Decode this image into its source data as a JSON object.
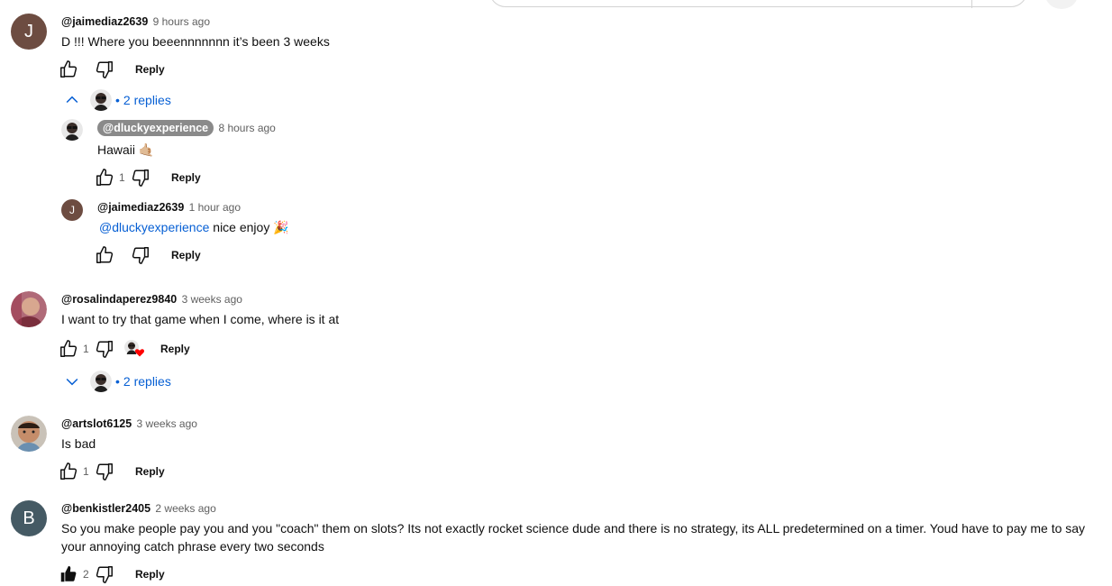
{
  "comments": [
    {
      "handle": "@jaimediaz2639",
      "time": "9 hours ago",
      "avatar_letter": "J",
      "avatar_color": "#6d4c41",
      "text": "D !!! Where you beeennnnnnn it’s been 3 weeks",
      "likes": "",
      "reply_label": "Reply",
      "replies_label": "2 replies",
      "replies": [
        {
          "handle": "@dluckyexperience",
          "time": "8 hours ago",
          "text": "Hawaii 🤙🏼",
          "likes": "1",
          "reply_label": "Reply"
        },
        {
          "handle": "@jaimediaz2639",
          "time": "1 hour ago",
          "avatar_letter": "J",
          "avatar_color": "#6d4c41",
          "mention": "@dluckyexperience",
          "text": " nice enjoy 🎉",
          "likes": "",
          "reply_label": "Reply"
        }
      ]
    },
    {
      "handle": "@rosalindaperez9840",
      "time": "3 weeks ago",
      "text": "I want to try that game when I come, where is it at",
      "likes": "1",
      "reply_label": "Reply",
      "replies_label": "2 replies"
    },
    {
      "handle": "@artslot6125",
      "time": "3 weeks ago",
      "text": "Is bad",
      "likes": "1",
      "reply_label": "Reply"
    },
    {
      "handle": "@benkistler2405",
      "time": "2 weeks ago",
      "avatar_letter": "B",
      "avatar_color": "#455a64",
      "text": "So you make people pay you and you \"coach\" them on slots? Its not exactly rocket science dude and there is no strategy, its ALL predetermined on a timer. Youd have to pay me to say your annoying catch phrase every two seconds",
      "likes": "2",
      "reply_label": "Reply"
    }
  ],
  "colors": {
    "link": "#065fd4",
    "secondary_text": "#606060",
    "creator_badge": "#8a8a8a"
  },
  "icons": [
    "thumb-up-icon",
    "thumb-down-icon",
    "chevron-up-icon",
    "chevron-down-icon",
    "heart-icon"
  ]
}
